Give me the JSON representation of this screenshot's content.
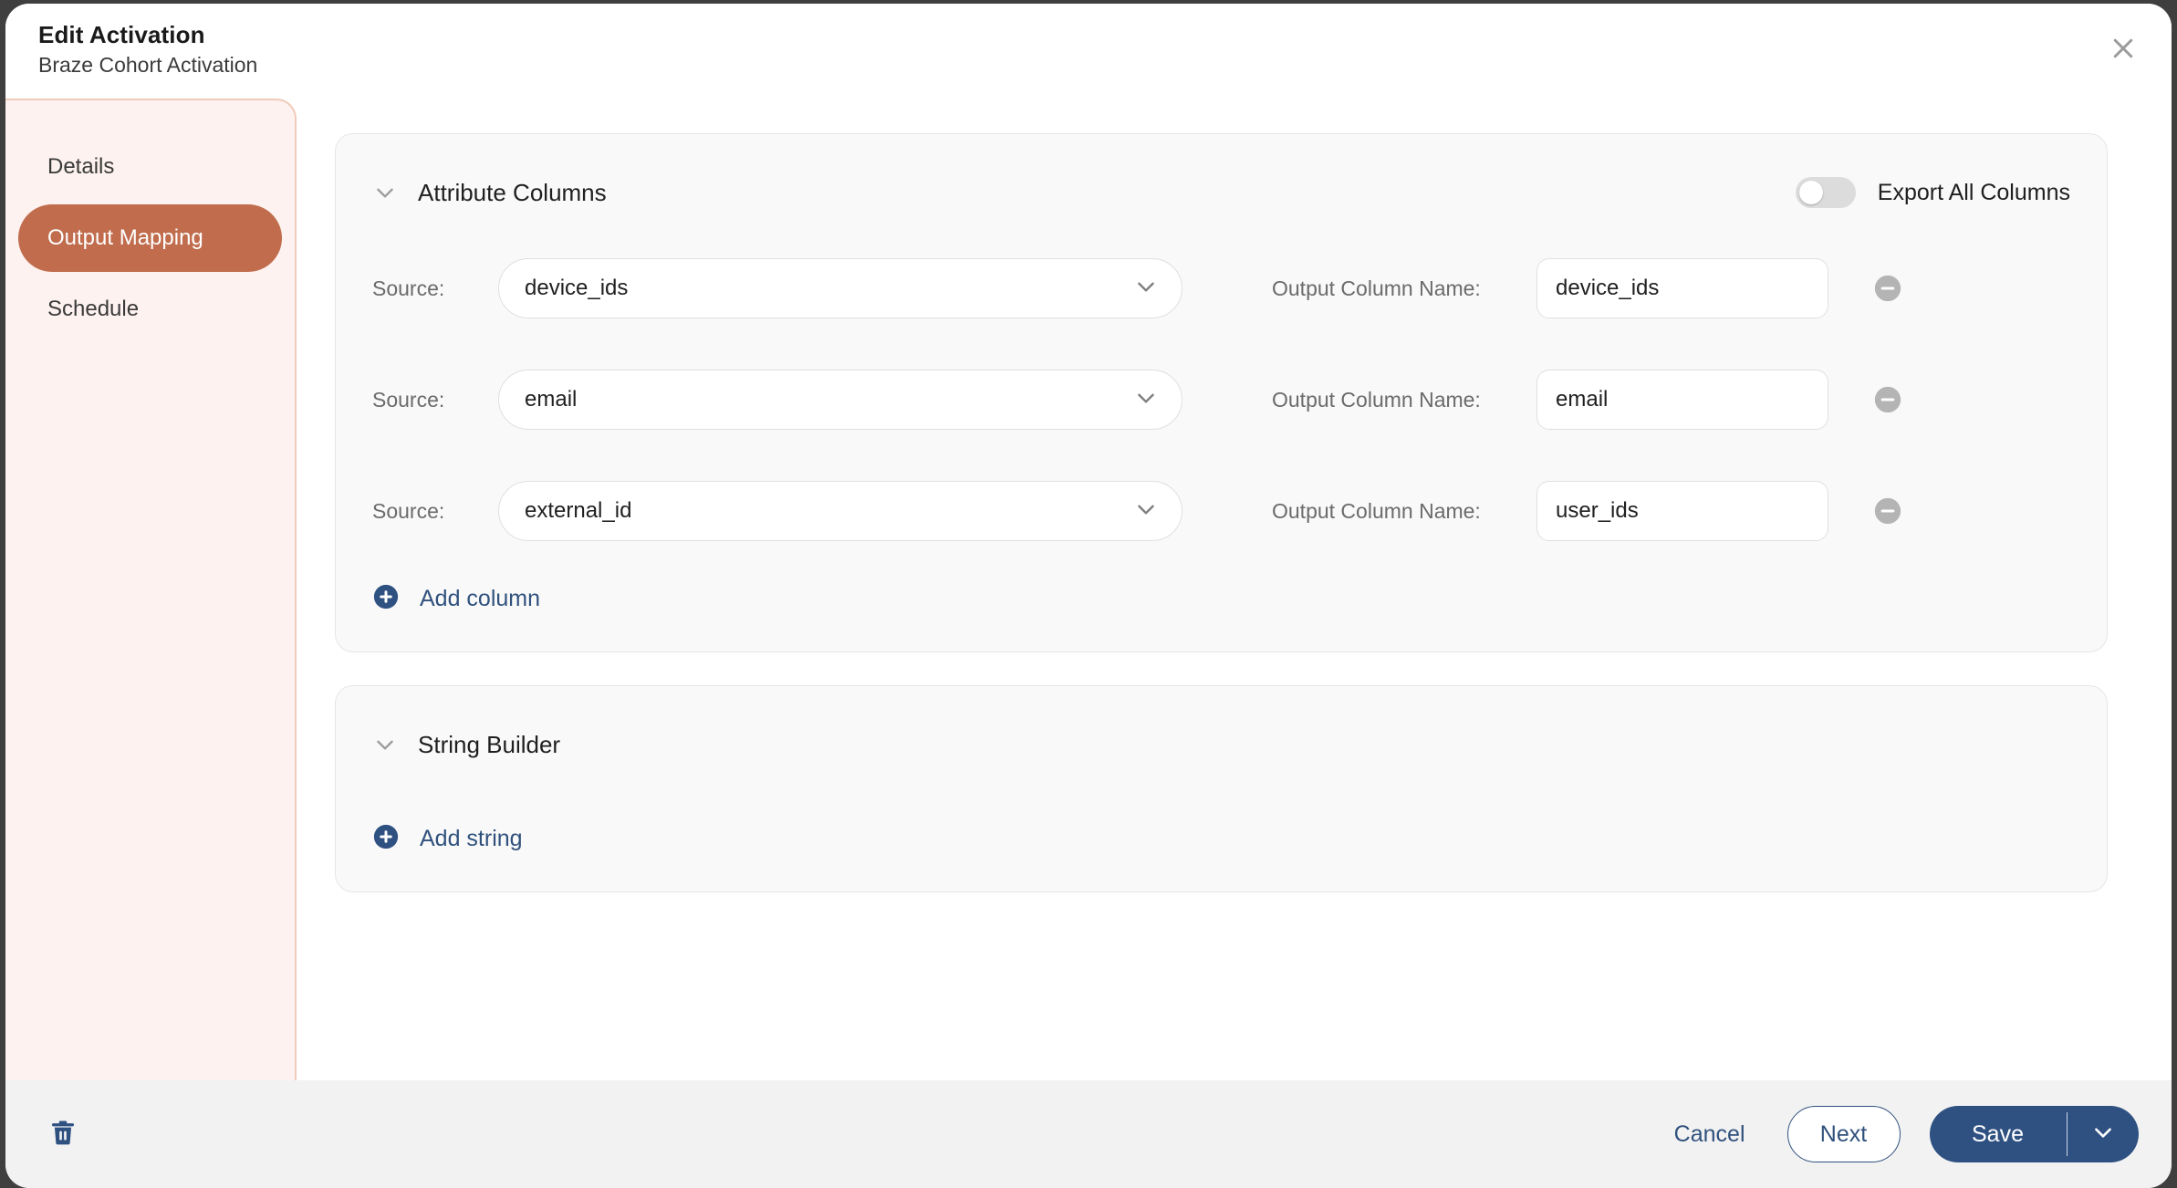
{
  "header": {
    "title": "Edit Activation",
    "subtitle": "Braze Cohort Activation",
    "close_icon": "close-icon"
  },
  "sidebar": {
    "items": [
      {
        "label": "Details",
        "active": false
      },
      {
        "label": "Output Mapping",
        "active": true
      },
      {
        "label": "Schedule",
        "active": false
      }
    ],
    "active_color": "#c06c4d",
    "background_color": "#fdf2ef"
  },
  "attribute_columns": {
    "title": "Attribute Columns",
    "collapse_icon": "chevron-down-icon",
    "export_all": {
      "label": "Export All Columns",
      "enabled": false
    },
    "source_label": "Source:",
    "output_label": "Output Column Name:",
    "rows": [
      {
        "source": "device_ids",
        "output": "device_ids"
      },
      {
        "source": "email",
        "output": "email"
      },
      {
        "source": "external_id",
        "output": "user_ids"
      }
    ],
    "add_label": "Add column"
  },
  "string_builder": {
    "title": "String Builder",
    "collapse_icon": "chevron-down-icon",
    "add_label": "Add string"
  },
  "footer": {
    "delete_icon": "trash-icon",
    "cancel_label": "Cancel",
    "next_label": "Next",
    "save_label": "Save",
    "save_caret_icon": "chevron-down-icon",
    "accent_color": "#2f5182"
  }
}
